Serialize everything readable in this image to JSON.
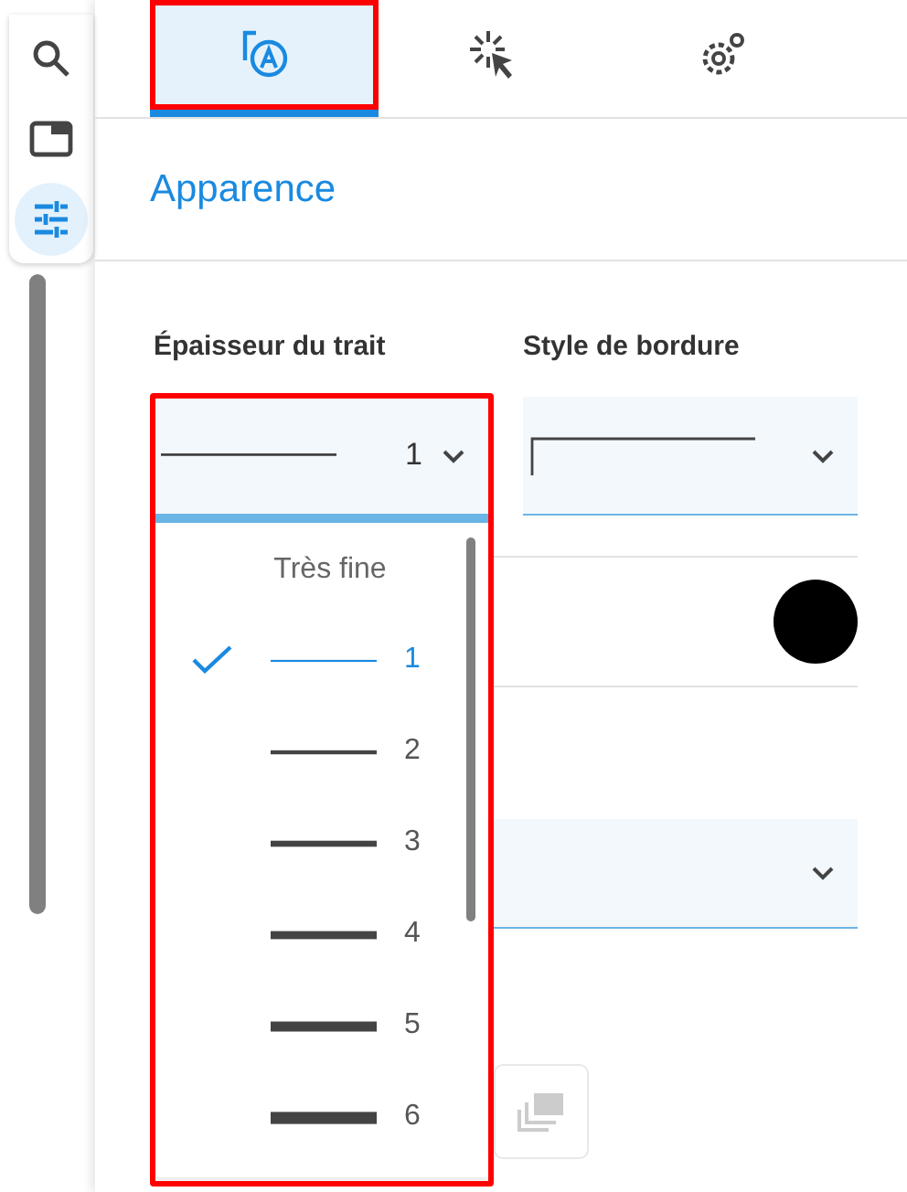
{
  "rail": [
    {
      "kind": "search",
      "selected": false
    },
    {
      "kind": "window",
      "selected": false
    },
    {
      "kind": "sliders",
      "selected": true
    }
  ],
  "tabs": [
    {
      "kind": "appearance",
      "selected": true,
      "highlighted": true
    },
    {
      "kind": "click",
      "selected": false,
      "highlighted": false
    },
    {
      "kind": "gears",
      "selected": false,
      "highlighted": false
    }
  ],
  "section": {
    "title": "Apparence"
  },
  "line_width": {
    "label": "Épaisseur du trait",
    "value": "1",
    "open": true,
    "highlighted": true
  },
  "border_style": {
    "label": "Style de bordure"
  },
  "color_swatch": {
    "color": "#000000"
  },
  "dropdown": {
    "header": "Très fine",
    "options": [
      {
        "label": "1",
        "selected": true
      },
      {
        "label": "2",
        "selected": false
      },
      {
        "label": "3",
        "selected": false
      },
      {
        "label": "4",
        "selected": false
      },
      {
        "label": "5",
        "selected": false
      },
      {
        "label": "6",
        "selected": false
      }
    ]
  },
  "layers_button": {
    "disabled": true
  }
}
